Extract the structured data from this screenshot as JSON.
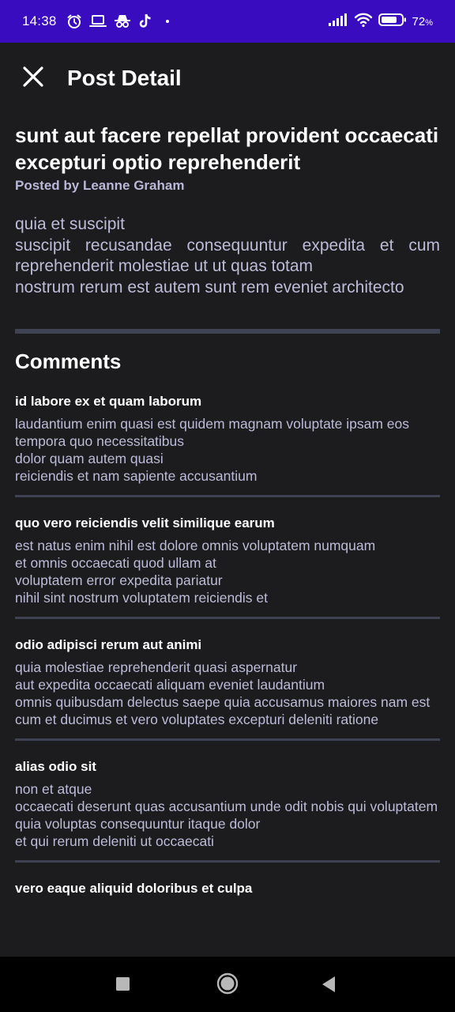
{
  "status_bar": {
    "time": "14:38",
    "battery": "72",
    "battery_unit": "%",
    "icons": [
      "alarm-icon",
      "laptop-icon",
      "incognito-icon",
      "tiktok-icon",
      "signal-icon",
      "wifi-icon",
      "battery-icon"
    ]
  },
  "app_bar": {
    "title": "Post Detail",
    "close_icon": "close-icon"
  },
  "post": {
    "title": "sunt aut facere repellat provident occaecati excepturi optio reprehenderit",
    "author": "Posted by Leanne Graham",
    "body": "quia et suscipit\nsuscipit recusandae consequuntur expedita et cum reprehenderit molestiae ut ut quas totam\nnostrum rerum est autem sunt rem eveniet architecto"
  },
  "comments_section": {
    "title": "Comments",
    "items": [
      {
        "title": "id labore ex et quam laborum",
        "body": "laudantium enim quasi est quidem magnam voluptate ipsam eos\ntempora quo necessitatibus\ndolor quam autem quasi\nreiciendis et nam sapiente accusantium"
      },
      {
        "title": "quo vero reiciendis velit similique earum",
        "body": "est natus enim nihil est dolore omnis voluptatem numquam\net omnis occaecati quod ullam at\nvoluptatem error expedita pariatur\nnihil sint nostrum voluptatem reiciendis et"
      },
      {
        "title": "odio adipisci rerum aut animi",
        "body": "quia molestiae reprehenderit quasi aspernatur\naut expedita occaecati aliquam eveniet laudantium\nomnis quibusdam delectus saepe quia accusamus maiores nam est\ncum et ducimus et vero voluptates excepturi deleniti ratione"
      },
      {
        "title": "alias odio sit",
        "body": "non et atque\noccaecati deserunt quas accusantium unde odit nobis qui voluptatem\nquia voluptas consequuntur itaque dolor\net qui rerum deleniti ut occaecati"
      },
      {
        "title": "vero eaque aliquid doloribus et culpa",
        "body": ""
      }
    ]
  },
  "nav_bar": {
    "buttons": [
      "recents-square-icon",
      "home-circle-icon",
      "back-triangle-icon"
    ]
  },
  "colors": {
    "status_bar_bg": "#3a0cc0",
    "background": "#1c1c1e",
    "body_text": "#bcbcd8",
    "divider": "#3e4252"
  }
}
